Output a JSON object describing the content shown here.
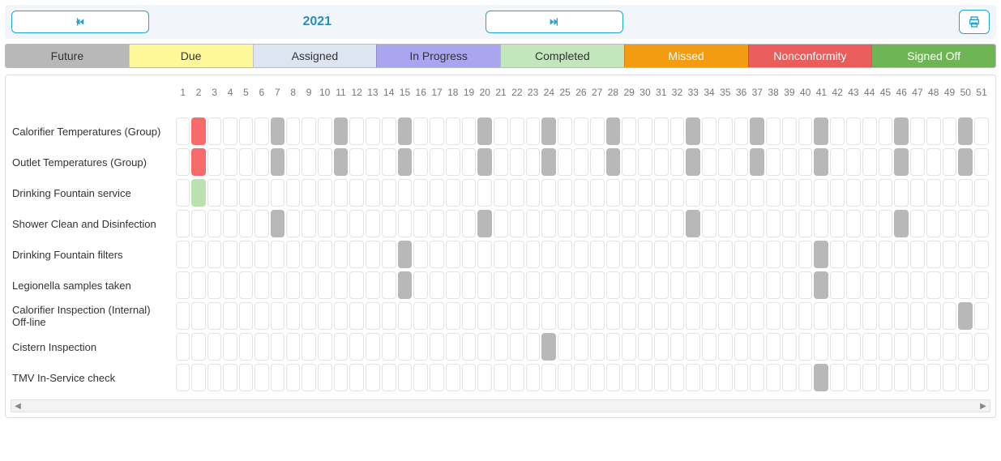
{
  "nav": {
    "year": "2021"
  },
  "legend": [
    {
      "label": "Future",
      "color_bg": "#b8b8b8",
      "color_text": "#333"
    },
    {
      "label": "Due",
      "color_bg": "#fff89a",
      "color_text": "#333"
    },
    {
      "label": "Assigned",
      "color_bg": "#dde4f2",
      "color_text": "#333"
    },
    {
      "label": "In Progress",
      "color_bg": "#a9a5ef",
      "color_text": "#333"
    },
    {
      "label": "Completed",
      "color_bg": "#c4e6bd",
      "color_text": "#333"
    },
    {
      "label": "Missed",
      "color_bg": "#f39c12",
      "color_text": "#fff"
    },
    {
      "label": "Nonconformity",
      "color_bg": "#e95d5d",
      "color_text": "#fff"
    },
    {
      "label": "Signed Off",
      "color_bg": "#6fb556",
      "color_text": "#fff"
    }
  ],
  "weeks": [
    1,
    2,
    3,
    4,
    5,
    6,
    7,
    8,
    9,
    10,
    11,
    12,
    13,
    14,
    15,
    16,
    17,
    18,
    19,
    20,
    21,
    22,
    23,
    24,
    25,
    26,
    27,
    28,
    29,
    30,
    31,
    32,
    33,
    34,
    35,
    36,
    37,
    38,
    39,
    40,
    41,
    42,
    43,
    44,
    45,
    46,
    47,
    48,
    49,
    50,
    51
  ],
  "tasks": [
    {
      "name": "Calorifier Temperatures (Group)",
      "cells": {
        "2": "nonconformity",
        "7": "future",
        "11": "future",
        "15": "future",
        "20": "future",
        "24": "future",
        "28": "future",
        "33": "future",
        "37": "future",
        "41": "future",
        "46": "future",
        "50": "future"
      }
    },
    {
      "name": "Outlet Temperatures (Group)",
      "cells": {
        "2": "nonconformity",
        "7": "future",
        "11": "future",
        "15": "future",
        "20": "future",
        "24": "future",
        "28": "future",
        "33": "future",
        "37": "future",
        "41": "future",
        "46": "future",
        "50": "future"
      }
    },
    {
      "name": "Drinking Fountain service",
      "cells": {
        "2": "completed"
      }
    },
    {
      "name": "Shower Clean and Disinfection",
      "cells": {
        "7": "future",
        "20": "future",
        "33": "future",
        "46": "future"
      }
    },
    {
      "name": "Drinking Fountain filters",
      "cells": {
        "15": "future",
        "41": "future"
      }
    },
    {
      "name": "Legionella samples taken",
      "cells": {
        "15": "future",
        "41": "future"
      }
    },
    {
      "name": "Calorifier Inspection (Internal) Off-line",
      "cells": {
        "50": "future"
      }
    },
    {
      "name": "Cistern Inspection",
      "cells": {
        "24": "future"
      }
    },
    {
      "name": "TMV In-Service check",
      "cells": {
        "41": "future"
      }
    }
  ]
}
